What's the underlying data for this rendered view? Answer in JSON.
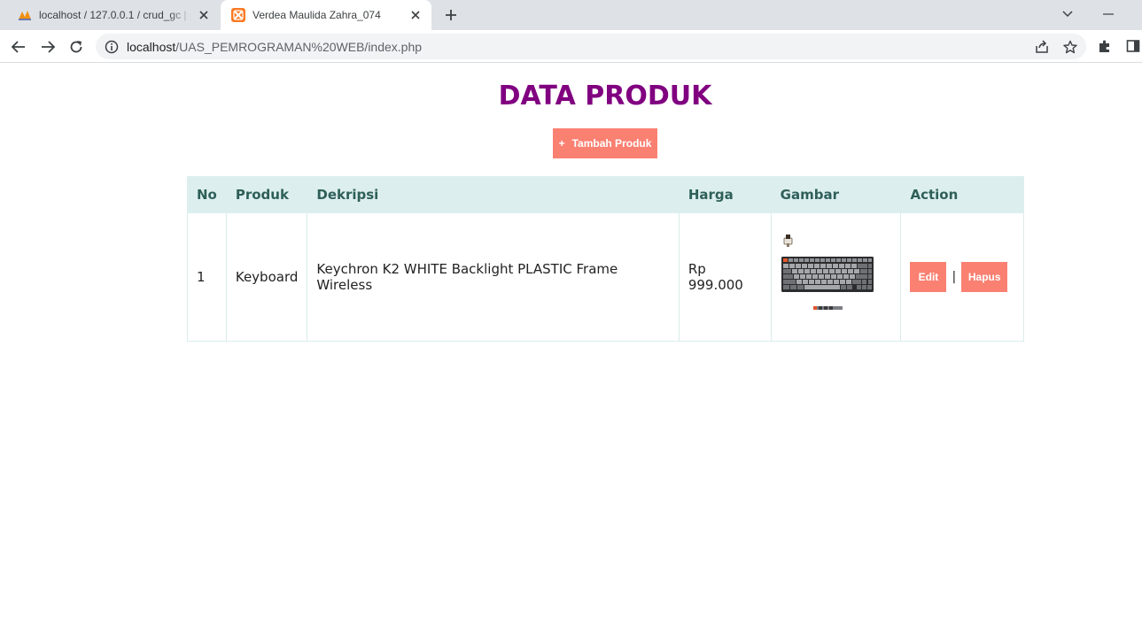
{
  "browser": {
    "tabs": [
      {
        "title": "localhost / 127.0.0.1 / crud_gc | p",
        "active": false,
        "favicon": "phpmyadmin-icon"
      },
      {
        "title": "Verdea Maulida Zahra_074",
        "active": true,
        "favicon": "xampp-icon"
      }
    ],
    "url_host": "localhost",
    "url_path": "/UAS_PEMROGRAMAN%20WEB/index.php"
  },
  "page": {
    "title": "DATA PRODUK",
    "add_button": {
      "icon": "+",
      "label": "Tambah Produk"
    },
    "table": {
      "headers": [
        "No",
        "Produk",
        "Dekripsi",
        "Harga",
        "Gambar",
        "Action"
      ],
      "rows": [
        {
          "no": "1",
          "produk": "Keyboard",
          "deskripsi": "Keychron K2 WHITE Backlight PLASTIC Frame Wireless",
          "harga": "Rp 999.000",
          "gambar": "keyboard-product-image",
          "edit_label": "Edit",
          "separator": "|",
          "hapus_label": "Hapus"
        }
      ]
    }
  },
  "colors": {
    "title": "#800080",
    "button": "#fa8072",
    "table_header_bg": "#dcefee",
    "table_header_text": "#2f5f59"
  }
}
